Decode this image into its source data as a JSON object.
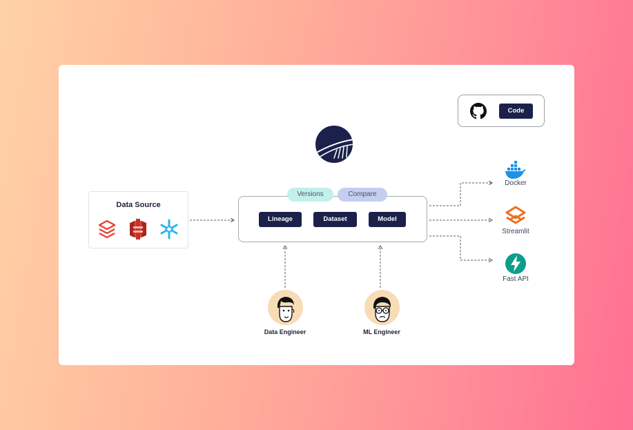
{
  "data_source": {
    "title": "Data Source",
    "icons": [
      "databricks-icon",
      "aws-s3-icon",
      "snowflake-icon"
    ]
  },
  "tags": {
    "versions": "Versions",
    "compare": "Compare"
  },
  "main_buttons": {
    "lineage": "Lineage",
    "dataset": "Dataset",
    "model": "Model"
  },
  "code_panel": {
    "icon": "github-icon",
    "button": "Code"
  },
  "deployments": {
    "docker": "Docker",
    "streamlit": "Streamlit",
    "fastapi": "Fast API"
  },
  "people": {
    "data_engineer": "Data Engineer",
    "ml_engineer": "ML Engineer"
  },
  "colors": {
    "navy": "#1b214a",
    "versions_tag": "#c2f0ea",
    "compare_tag": "#c6ceef",
    "docker": "#1d91e6",
    "streamlit": "#e8711f",
    "fastapi": "#0b9e8b",
    "databricks": "#e8412e",
    "aws_s3": "#d93b2b",
    "snowflake": "#29b5e8",
    "avatar_bg": "#f7dcb6"
  }
}
